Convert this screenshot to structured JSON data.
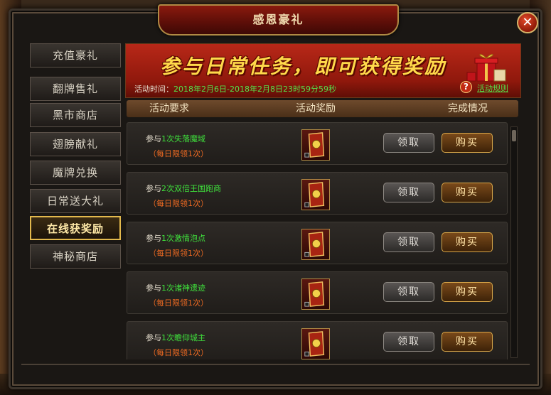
{
  "window": {
    "title": "感恩豪礼",
    "close_symbol": "✕"
  },
  "sidebar": {
    "items": [
      {
        "label": "充值豪礼",
        "active": false
      },
      {
        "label": "翻牌售礼",
        "active": false
      },
      {
        "label": "黑市商店",
        "active": false
      },
      {
        "label": "翅膀献礼",
        "active": false
      },
      {
        "label": "魔牌兑换",
        "active": false
      },
      {
        "label": "日常送大礼",
        "active": false
      },
      {
        "label": "在线获奖励",
        "active": true
      },
      {
        "label": "神秘商店",
        "active": false
      }
    ]
  },
  "banner": {
    "headline": "参与日常任务，即可获得奖励",
    "time_label": "活动时间：",
    "time_value": "2018年2月6日-2018年2月8日23时59分59秒",
    "help_symbol": "?",
    "rules_link": "活动规则",
    "gift_icon": "gift-box-icon"
  },
  "columns": {
    "requirement": "活动要求",
    "reward": "活动奖励",
    "status": "完成情况"
  },
  "tasks": [
    {
      "prefix": "参与",
      "task": "1次失落魔域",
      "limit": "（每日限领1次）",
      "claim": "领取",
      "buy": "购买"
    },
    {
      "prefix": "参与",
      "task": "2次双倍王国跑商",
      "limit": "（每日限领1次）",
      "claim": "领取",
      "buy": "购买"
    },
    {
      "prefix": "参与",
      "task": "1次激情泡点",
      "limit": "（每日限领1次）",
      "claim": "领取",
      "buy": "购买"
    },
    {
      "prefix": "参与",
      "task": "1次诸神遗迹",
      "limit": "（每日限领1次）",
      "claim": "领取",
      "buy": "购买"
    },
    {
      "prefix": "参与",
      "task": "1次瞻仰城主",
      "limit": "（每日限领1次）",
      "claim": "领取",
      "buy": "购买"
    }
  ],
  "colors": {
    "accent_gold": "#e3b94d",
    "task_green": "#3fe03c",
    "limit_orange": "#ee6a22",
    "banner_red": "#b82818"
  }
}
